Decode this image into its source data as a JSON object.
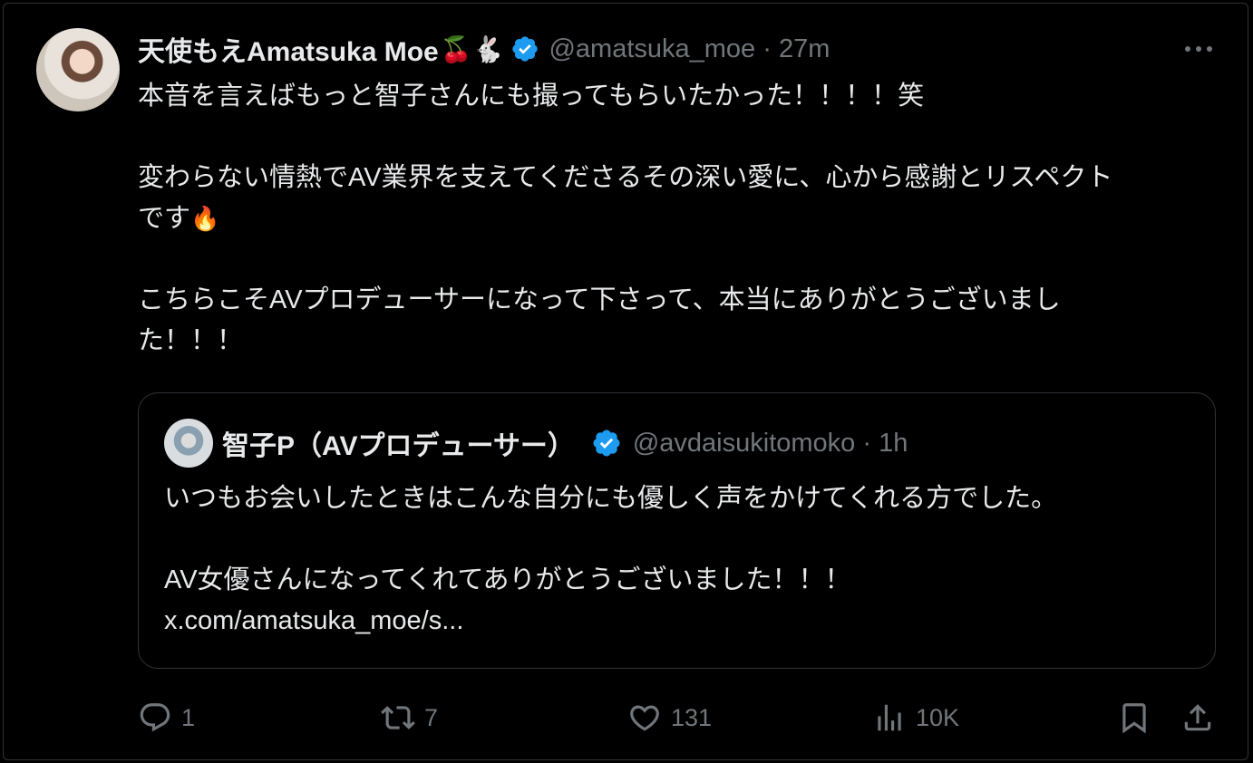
{
  "tweet": {
    "author": {
      "display_name": "天使もえAmatsuka Moe",
      "name_emojis": "🍒🐇",
      "handle_time": "@amatsuka_moe · 27m"
    },
    "lines": {
      "l1": "本音を言えばもっと智子さんにも撮ってもらいたかった！！！！笑",
      "l2a": "変わらない情熱でAV業界を支えてくださるその深い愛に、心から感謝とリスペクト",
      "l2b": "です",
      "l2_emoji": "🔥",
      "l3a": "こちらこそAVプロデューサーになって下さって、本当にありがとうございまし",
      "l3b": "た！！！"
    }
  },
  "quote": {
    "author": {
      "display_name": "智子P（AVプロデューサー）",
      "handle_time": "@avdaisukitomoko · 1h"
    },
    "lines": {
      "l1": "いつもお会いしたときはこんな自分にも優しく声をかけてくれる方でした。",
      "l2": "AV女優さんになってくれてありがとうございました！！！",
      "link": "x.com/amatsuka_moe/s..."
    }
  },
  "actions": {
    "reply_count": "1",
    "repost_count": "7",
    "like_count": "131",
    "views_count": "10K"
  },
  "colors": {
    "background": "#000000",
    "text": "#e7e9ea",
    "muted": "#71767b",
    "verified": "#1d9bf0",
    "border": "#2f3336"
  },
  "icons": [
    "verified-badge-icon",
    "more-icon",
    "reply-icon",
    "repost-icon",
    "like-icon",
    "views-icon",
    "bookmark-icon",
    "share-icon"
  ]
}
